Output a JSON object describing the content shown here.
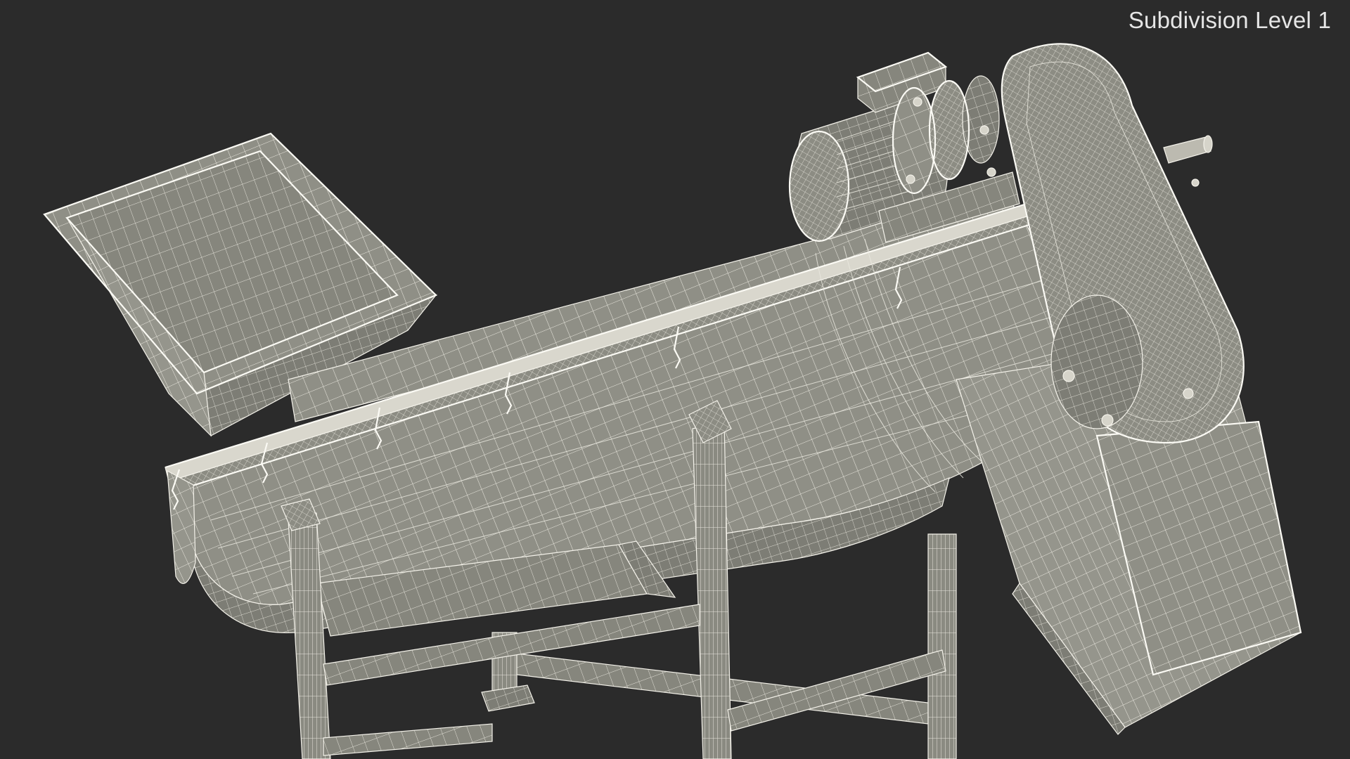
{
  "viewport": {
    "overlay_label": "Subdivision Level 1",
    "background_color": "#2b2b2b",
    "mesh_face_color": "#8e8e84",
    "mesh_wire_color": "#f4f2ea"
  },
  "scene": {
    "object": "inclined screw conveyor with hopper, gear motor and support frame",
    "render_style": "wireframe-over-shaded"
  }
}
